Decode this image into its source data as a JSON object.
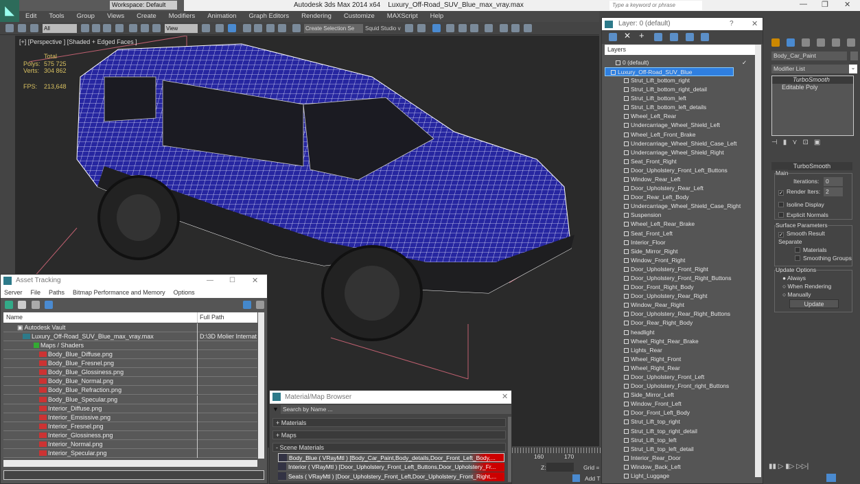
{
  "app": {
    "title": "Autodesk 3ds Max  2014 x64",
    "file": "Luxury_Off-Road_SUV_Blue_max_vray.max",
    "workspace": "Workspace: Default",
    "search_placeholder": "Type a keyword or phrase"
  },
  "menu": [
    "Edit",
    "Tools",
    "Group",
    "Views",
    "Create",
    "Modifiers",
    "Animation",
    "Graph Editors",
    "Rendering",
    "Customize",
    "MAXScript",
    "Help"
  ],
  "toolbar": {
    "filter": "All",
    "coord": "View",
    "selection_set": "Create Selection Se",
    "squid": "Squid Studio v"
  },
  "viewport": {
    "label": "[+] [Perspective ] [Shaded + Edged Faces ]",
    "stats_header": "Total",
    "polys_label": "Polys:",
    "polys": "575 725",
    "verts_label": "Verts:",
    "verts": "304 862",
    "fps_label": "FPS:",
    "fps": "213,648",
    "wire_color": "#2a2aa8"
  },
  "layer_dialog": {
    "title": "Layer: 0 (default)",
    "help": "?",
    "header": "Layers",
    "layers": [
      "0 (default)",
      "Luxury_Off-Road_SUV_Blue"
    ],
    "objects": [
      "Strut_Lift_bottom_right",
      "Strut_Lift_bottom_right_detail",
      "Strut_Lift_bottom_left",
      "Strut_Lift_bottom_left_details",
      "Wheel_Left_Rear",
      "Undercarriage_Wheel_Shield_Left",
      "Wheel_Left_Front_Brake",
      "Undercarriage_Wheel_Shield_Case_Left",
      "Undercarriage_Wheel_Shield_Right",
      "Seat_Front_Right",
      "Door_Upholstery_Front_Left_Buttons",
      "Window_Rear_Left",
      "Door_Upholstery_Rear_Left",
      "Door_Rear_Left_Body",
      "Undercarriage_Wheel_Shield_Case_Right",
      "Suspension",
      "Wheel_Left_Rear_Brake",
      "Seat_Front_Left",
      "Interior_Floor",
      "Side_Mirror_Right",
      "Window_Front_Right",
      "Door_Upholstery_Front_Right",
      "Door_Upholstery_Front_Right_Buttons",
      "Door_Front_Right_Body",
      "Door_Upholstery_Rear_Right",
      "Window_Rear_Right",
      "Door_Upholstery_Rear_Right_Buttons",
      "Door_Rear_Right_Body",
      "headlight",
      "Wheel_Right_Rear_Brake",
      "Lights_Rear",
      "Wheel_Right_Front",
      "Wheel_Right_Rear",
      "Door_Upholstery_Front_Left",
      "Door_Upholstery_Front_right_Buttons",
      "Side_Mirror_Left",
      "Window_Front_Left",
      "Door_Front_Left_Body",
      "Strut_Lift_top_right",
      "Strut_Lift_top_right_detail",
      "Strut_Lift_top_left",
      "Strut_Lift_top_left_detail",
      "Interior_Rear_Door",
      "Window_Back_Left",
      "Light_Luggage"
    ]
  },
  "command_panel": {
    "object_name": "Body_Car_Paint",
    "modifier_list": "Modifier List",
    "stack": [
      "TurboSmooth",
      "Editable Poly"
    ],
    "rollout": "TurboSmooth",
    "main": "Main",
    "iterations_label": "Iterations:",
    "iterations": "0",
    "render_iters_label": "Render Iters:",
    "render_iters": "2",
    "isoline": "Isoline Display",
    "explicit": "Explicit Normals",
    "surface": "Surface Parameters",
    "smooth_result": "Smooth Result",
    "separate": "Separate",
    "materials": "Materials",
    "smoothing_groups": "Smoothing Groups",
    "update_options": "Update Options",
    "always": "Always",
    "when_rendering": "When Rendering",
    "manually": "Manually",
    "update": "Update"
  },
  "asset_tracking": {
    "title": "Asset Tracking",
    "menu": [
      "Server",
      "File",
      "Paths",
      "Bitmap Performance and Memory",
      "Options"
    ],
    "col_name": "Name",
    "col_path": "Full Path",
    "vault": "Autodesk Vault",
    "file": "Luxury_Off-Road_SUV_Blue_max_vray.max",
    "file_path": "D:\\3D Molier Internat",
    "maps": "Maps / Shaders",
    "files": [
      "Body_Blue_Diffuse.png",
      "Body_Blue_Fresnel.png",
      "Body_Blue_Glossiness.png",
      "Body_Blue_Normal.png",
      "Body_Blue_Refraction.png",
      "Body_Blue_Specular.png",
      "Interior_Diffuse.png",
      "Interior_Emsissive.png",
      "Interior_Fresnel.png",
      "Interior_Glossiness.png",
      "Interior_Normal.png",
      "Interior_Specular.png"
    ]
  },
  "material_browser": {
    "title": "Material/Map Browser",
    "search": "Search by Name ...",
    "sections": [
      "+ Materials",
      "+ Maps",
      "- Scene Materials"
    ],
    "materials": [
      "Body_Blue ( VRayMtl ) [Body_Car_Paint,Body_details,Door_Front_Left_Body,...",
      "Interior ( VRayMtl ) [Door_Upholstery_Front_Left_Buttons,Door_Upholstery_Fr...",
      "Seats ( VRayMtl ) [Door_Upholstery_Front_Left,Door_Upholstery_Front_Right,..."
    ]
  },
  "timeline": {
    "ticks": [
      "160",
      "170"
    ],
    "z_label": "Z:",
    "grid": "Grid =",
    "add_time": "Add T"
  }
}
